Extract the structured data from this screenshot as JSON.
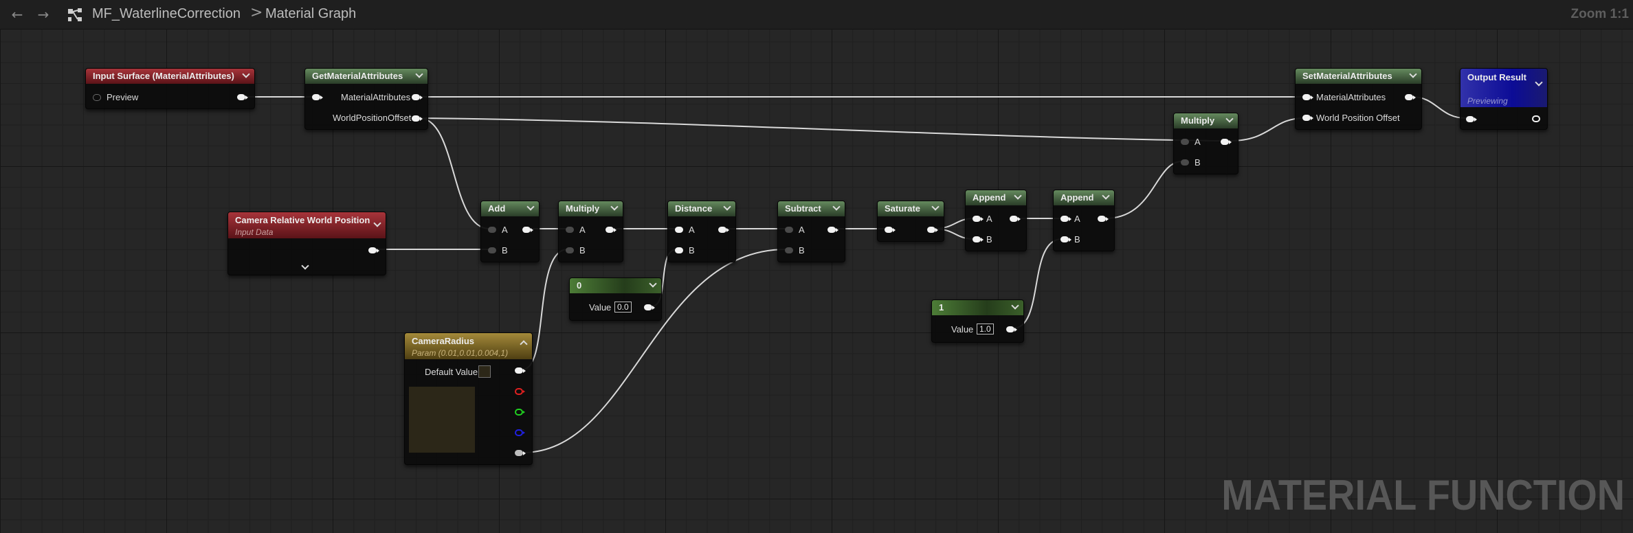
{
  "toolbar": {
    "back_icon": "arrow-left-icon",
    "forward_icon": "arrow-right-icon",
    "graph_icon": "material-graph-icon",
    "asset_name": "MF_WaterlineCorrection",
    "separator": ">",
    "graph_name": "Material Graph",
    "zoom": "Zoom 1:1"
  },
  "watermark": "MATERIAL FUNCTION",
  "colors": {
    "pin_white": "#f2f2f2",
    "wire": "#d9d9d9",
    "header_green": "#4f7048",
    "header_red": "#8c2228",
    "header_gold": "#8a7128",
    "header_blue": "#1a1aa0",
    "param_red": "#e02020",
    "param_green": "#20d020",
    "param_blue": "#2020e0"
  },
  "nodes": {
    "input_surface": {
      "title": "Input Surface (MaterialAttributes)",
      "pin": "Preview"
    },
    "get_attrs": {
      "title": "GetMaterialAttributes",
      "out1": "MaterialAttributes",
      "out2": "WorldPositionOffset"
    },
    "camera_pos": {
      "title": "Camera Relative World Position",
      "subtitle": "Input Data"
    },
    "add": {
      "title": "Add",
      "a": "A",
      "b": "B"
    },
    "multiply1": {
      "title": "Multiply",
      "a": "A",
      "b": "B"
    },
    "const0": {
      "title": "0",
      "value_label": "Value",
      "value": "0.0"
    },
    "distance": {
      "title": "Distance",
      "a": "A",
      "b": "B"
    },
    "subtract": {
      "title": "Subtract",
      "a": "A",
      "b": "B"
    },
    "saturate": {
      "title": "Saturate"
    },
    "append1": {
      "title": "Append",
      "a": "A",
      "b": "B"
    },
    "append2": {
      "title": "Append",
      "a": "A",
      "b": "B"
    },
    "const1": {
      "title": "1",
      "value_label": "Value",
      "value": "1.0"
    },
    "multiply2": {
      "title": "Multiply",
      "a": "A",
      "b": "B"
    },
    "camera_radius": {
      "title": "CameraRadius",
      "subtitle": "Param (0.01,0.01,0.004,1)",
      "default_label": "Default Value"
    },
    "set_attrs": {
      "title": "SetMaterialAttributes",
      "in1": "MaterialAttributes",
      "in2": "World Position Offset"
    },
    "output": {
      "title": "Output Result",
      "subtitle": "Previewing"
    }
  }
}
